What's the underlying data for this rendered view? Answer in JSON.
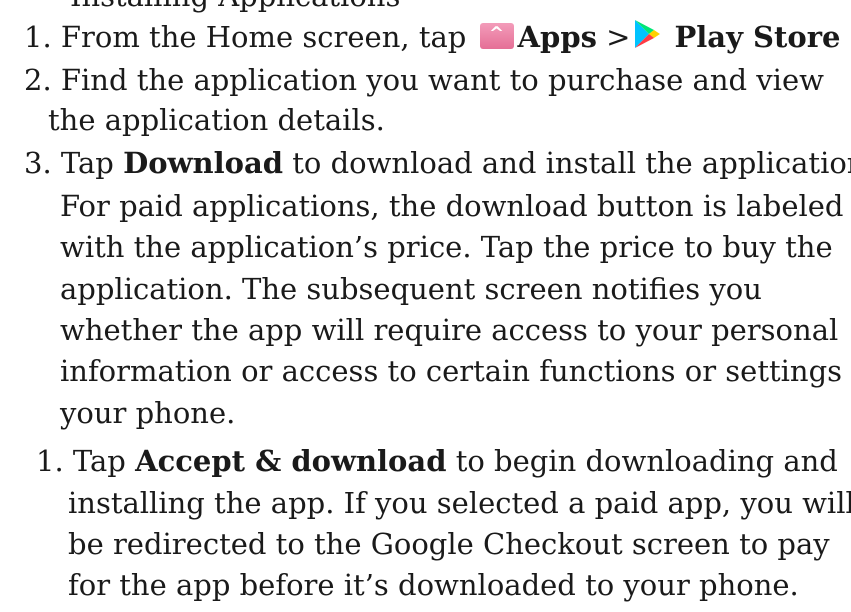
{
  "cut_top_text": "Installing Applications",
  "steps": {
    "s1": {
      "num": "1.",
      "lead": "From the Home screen, tap",
      "apps_label": "Apps",
      "separator": ">",
      "store_label": "Play Store"
    },
    "s2": {
      "num": "2.",
      "line1": "Find the application you want to purchase and view",
      "line2": "the application details."
    },
    "s3": {
      "num": "3.",
      "tap": "Tap",
      "bold": "Download",
      "rest": "to download and install the application.",
      "lines": [
        "For paid applications, the download button is labeled",
        "with the application’s price. Tap the price to buy the",
        "application. The subsequent screen notifies you",
        "whether the app will require access to your personal",
        "information or access to certain functions or settings of",
        "your phone."
      ]
    },
    "sub1": {
      "num": "1.",
      "tap": "Tap",
      "bold": "Accept & download",
      "rest": "to begin downloading and",
      "lines": [
        "installing the app. If you selected a paid app, you will",
        "be redirected to the Google Checkout screen to pay",
        "for the app before it’s downloaded to your phone."
      ]
    }
  },
  "icons": {
    "apps": "apps-chevron-up-icon",
    "store": "play-store-icon",
    "apps_color": "#e977a0",
    "play_colors": [
      "#00c3ff",
      "#ffd100",
      "#ff3a44",
      "#00e676"
    ]
  }
}
